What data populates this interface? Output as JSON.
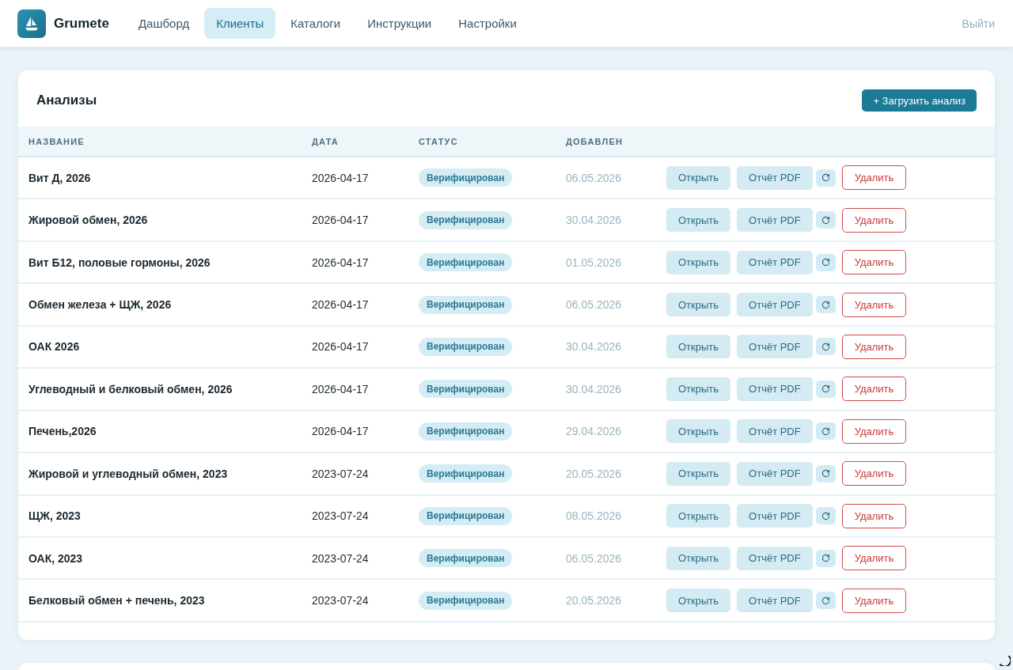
{
  "header": {
    "brand": "Grumete",
    "nav": [
      {
        "label": "Дашборд",
        "selected": false
      },
      {
        "label": "Клиенты",
        "selected": true
      },
      {
        "label": "Каталоги",
        "selected": false
      },
      {
        "label": "Инструкции",
        "selected": false
      },
      {
        "label": "Настройки",
        "selected": false
      }
    ],
    "logout": "Выйти"
  },
  "analyses": {
    "title": "Анализы",
    "upload_button": "+ Загрузить анализ",
    "columns": [
      "НАЗВАНИЕ",
      "ДАТА",
      "СТАТУС",
      "ДОБАВЛЕН"
    ],
    "rows": [
      {
        "name": "Вит Д, 2026",
        "date": "2026-04-17",
        "status": "Верифицирован",
        "added": "06.05.2026",
        "open_button": "Открыть",
        "pdf_button": "Отчёт PDF",
        "delete_button": "Удалить"
      },
      {
        "name": "Жировой обмен, 2026",
        "date": "2026-04-17",
        "status": "Верифицирован",
        "added": "30.04.2026",
        "open_button": "Открыть",
        "pdf_button": "Отчёт PDF",
        "delete_button": "Удалить"
      },
      {
        "name": "Вит Б12, половые гормоны, 2026",
        "date": "2026-04-17",
        "status": "Верифицирован",
        "added": "01.05.2026",
        "open_button": "Открыть",
        "pdf_button": "Отчёт PDF",
        "delete_button": "Удалить"
      },
      {
        "name": "Обмен железа + ЩЖ, 2026",
        "date": "2026-04-17",
        "status": "Верифицирован",
        "added": "06.05.2026",
        "open_button": "Открыть",
        "pdf_button": "Отчёт PDF",
        "delete_button": "Удалить"
      },
      {
        "name": "ОАК 2026",
        "date": "2026-04-17",
        "status": "Верифицирован",
        "added": "30.04.2026",
        "open_button": "Открыть",
        "pdf_button": "Отчёт PDF",
        "delete_button": "Удалить"
      },
      {
        "name": "Углеводный и белковый обмен, 2026",
        "date": "2026-04-17",
        "status": "Верифицирован",
        "added": "30.04.2026",
        "open_button": "Открыть",
        "pdf_button": "Отчёт PDF",
        "delete_button": "Удалить"
      },
      {
        "name": "Печень,2026",
        "date": "2026-04-17",
        "status": "Верифицирован",
        "added": "29.04.2026",
        "open_button": "Открыть",
        "pdf_button": "Отчёт PDF",
        "delete_button": "Удалить"
      },
      {
        "name": "Жировой и углеводный обмен, 2023",
        "date": "2023-07-24",
        "status": "Верифицирован",
        "added": "20.05.2026",
        "open_button": "Открыть",
        "pdf_button": "Отчёт PDF",
        "delete_button": "Удалить"
      },
      {
        "name": "ЩЖ, 2023",
        "date": "2023-07-24",
        "status": "Верифицирован",
        "added": "08.05.2026",
        "open_button": "Открыть",
        "pdf_button": "Отчёт PDF",
        "delete_button": "Удалить"
      },
      {
        "name": "ОАК, 2023",
        "date": "2023-07-24",
        "status": "Верифицирован",
        "added": "06.05.2026",
        "open_button": "Открыть",
        "pdf_button": "Отчёт PDF",
        "delete_button": "Удалить"
      },
      {
        "name": "Белковый обмен + печень, 2023",
        "date": "2023-07-24",
        "status": "Верифицирован",
        "added": "20.05.2026",
        "open_button": "Открыть",
        "pdf_button": "Отчёт PDF",
        "delete_button": "Удалить"
      }
    ]
  }
}
